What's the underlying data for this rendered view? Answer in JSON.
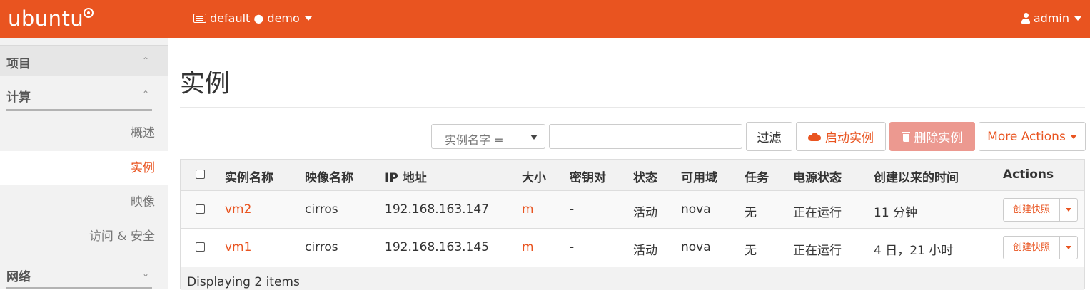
{
  "header": {
    "brand": "ubuntu",
    "project_selector": "default ● demo",
    "user": "admin"
  },
  "sidebar": {
    "project_title": "项目",
    "compute_title": "计算",
    "items": [
      {
        "label": "概述"
      },
      {
        "label": "实例"
      },
      {
        "label": "映像"
      },
      {
        "label": "访问 & 安全"
      }
    ],
    "network_title": "网络"
  },
  "main": {
    "title": "实例",
    "filter_select": "实例名字 =",
    "filter_input_value": "",
    "filter_button": "过滤",
    "launch_button": "启动实例",
    "delete_button": "删除实例",
    "more_actions": "More Actions"
  },
  "table": {
    "columns": [
      "实例名称",
      "映像名称",
      "IP 地址",
      "大小",
      "密钥对",
      "状态",
      "可用域",
      "任务",
      "电源状态",
      "创建以来的时间",
      "Actions"
    ],
    "rows": [
      {
        "name": "vm2",
        "image": "cirros",
        "ip": "192.168.163.147",
        "size": "m",
        "keypair": "-",
        "status": "活动",
        "zone": "nova",
        "task": "无",
        "power": "正在运行",
        "age": "11 分钟",
        "action": "创建快照"
      },
      {
        "name": "vm1",
        "image": "cirros",
        "ip": "192.168.163.145",
        "size": "m",
        "keypair": "-",
        "status": "活动",
        "zone": "nova",
        "task": "无",
        "power": "正在运行",
        "age": "4 日，21 小时",
        "action": "创建快照"
      }
    ],
    "footer": "Displaying 2 items"
  },
  "colors": {
    "brand_orange": "#e95420",
    "delete_disabled": "#ec9990"
  }
}
